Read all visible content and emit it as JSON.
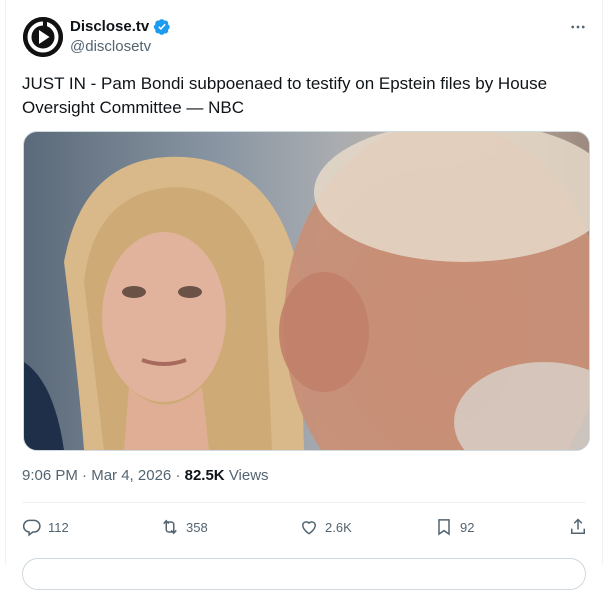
{
  "author": {
    "name": "Disclose.tv",
    "handle": "@disclosetv",
    "verified": true,
    "avatar_icon": "disclose-logo-icon"
  },
  "post": {
    "text": "JUST IN - Pam Bondi subpoenaed to testify on Epstein files by House Oversight Committee — NBC",
    "time": "9:06 PM",
    "date": "Mar 4, 2026",
    "views_count": "82.5K",
    "views_label": "Views"
  },
  "actions": {
    "replies": "112",
    "reposts": "358",
    "likes": "2.6K",
    "bookmarks": "92"
  },
  "colors": {
    "verified_blue": "#1d9bf0",
    "secondary_text": "#536471"
  }
}
